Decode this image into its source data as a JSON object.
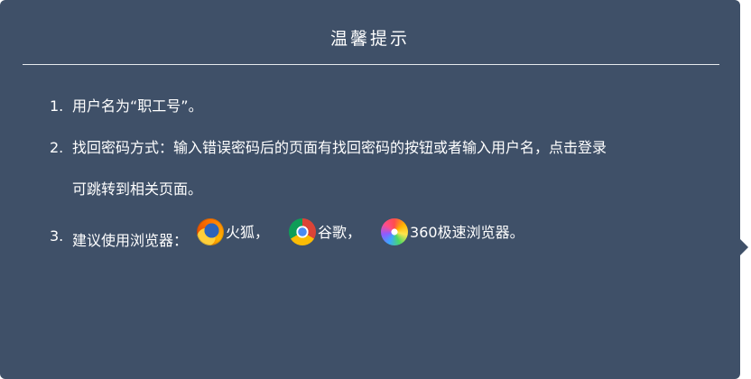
{
  "dialog": {
    "title": "温馨提示"
  },
  "items": [
    {
      "number": "1.",
      "text": "用户名为“职工号”。"
    },
    {
      "number": "2.",
      "text": "找回密码方式：输入错误密码后的页面有找回密码的按钮或者输入用户名，点击登录",
      "continuation": "可跳转到相关页面。"
    },
    {
      "number": "3.",
      "prefix": "建议使用浏览器：",
      "browsers": [
        {
          "icon": "firefox-icon",
          "label": "火狐，"
        },
        {
          "icon": "chrome-icon",
          "label": "谷歌，"
        },
        {
          "icon": "360-browser-icon",
          "label": "360极速浏览器。"
        }
      ]
    }
  ],
  "colors": {
    "panel_background": "#3f5068",
    "text": "#ffffff"
  }
}
